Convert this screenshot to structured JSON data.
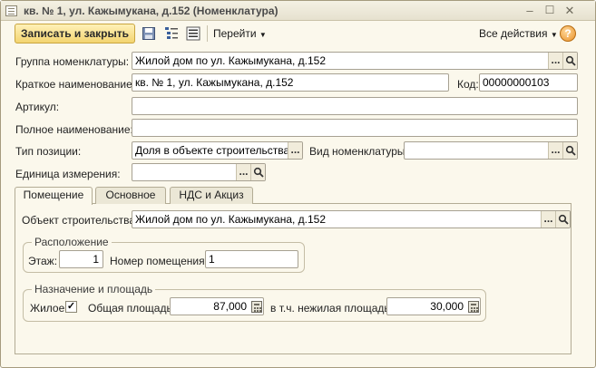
{
  "window": {
    "title": "кв. № 1, ул. Кажымукана, д.152 (Номенклатура)"
  },
  "toolbar": {
    "save_close_label": "Записать и закрыть",
    "goto_label": "Перейти",
    "all_actions_label": "Все действия",
    "help_label": "?"
  },
  "form": {
    "group_label": "Группа номенклатуры:",
    "group_value": "Жилой дом по ул. Кажымукана, д.152",
    "short_name_label": "Краткое наименование:",
    "short_name_value": "кв. № 1, ул. Кажымукана, д.152",
    "code_label": "Код:",
    "code_value": "00000000103",
    "article_label": "Артикул:",
    "article_value": "",
    "full_name_label": "Полное наименование:",
    "full_name_value": "",
    "position_type_label": "Тип позиции:",
    "position_type_value": "Доля в объекте строительства (і",
    "nomenclature_kind_label": "Вид номенклатуры:",
    "nomenclature_kind_value": "",
    "unit_label": "Единица измерения:",
    "unit_value": ""
  },
  "tabs": [
    {
      "label": "Помещение",
      "active": true
    },
    {
      "label": "Основное",
      "active": false
    },
    {
      "label": "НДС и Акциз",
      "active": false
    }
  ],
  "premises": {
    "object_label": "Объект строительства:",
    "object_value": "Жилой дом по ул. Кажымукана, д.152",
    "location_group": "Расположение",
    "floor_label": "Этаж:",
    "floor_value": "1",
    "room_number_label": "Номер помещения:",
    "room_number_value": "1",
    "purpose_group": "Назначение и площадь",
    "residential_label": "Жилое:",
    "residential_checked": true,
    "residential_mark": "✓",
    "total_area_label": "Общая площадь:",
    "total_area_value": "87,000",
    "nonresidential_area_label": "в т.ч. нежилая площадь:",
    "nonresidential_area_value": "30,000"
  },
  "icons": {
    "select": "...",
    "search": "search-icon",
    "calculator": "calculator-icon"
  },
  "colors": {
    "background": "#fbf8ec",
    "primary_button": "#f3d470",
    "help_button": "#e9912a"
  }
}
